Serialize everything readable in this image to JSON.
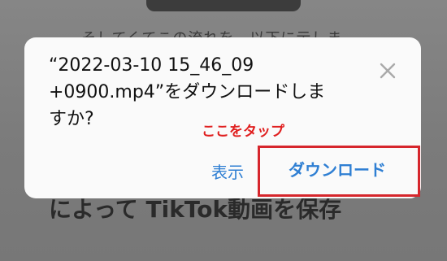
{
  "background": {
    "top_text": "そしてくてこの流れを、以下に示しま",
    "bottom_text": "によって TikTok動画を保存"
  },
  "dialog": {
    "message": "“2022-03-10 15_46_09\n+0900.mp4”をダウンロードしま\nすか?",
    "close_icon": "close-icon",
    "show_label": "表示",
    "download_label": "ダウンロード"
  },
  "annotation": {
    "label": "ここをタップ",
    "color": "#e02020"
  },
  "colors": {
    "accent": "#2f7fd3",
    "highlight_border": "#d6262c",
    "dialog_bg": "#fafafa",
    "overlay": "#7d7d7d"
  }
}
